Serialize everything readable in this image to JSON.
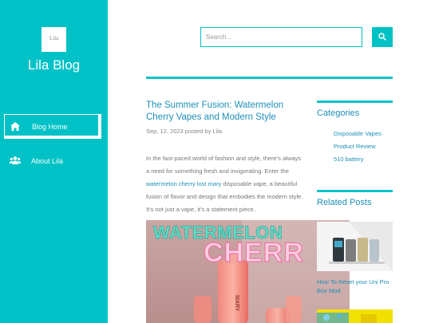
{
  "sidebar": {
    "logo_text": "Lila",
    "blog_title": "Lila Blog",
    "nav": [
      {
        "label": "Blog Home",
        "icon": "home-icon"
      },
      {
        "label": "About Lila",
        "icon": "users-icon"
      }
    ]
  },
  "search": {
    "placeholder": "Search...",
    "button_icon": "search-icon"
  },
  "post": {
    "title": "The Summer Fusion: Watermelon Cherry Vapes and Modern Style",
    "meta": "Sep, 12, 2023 posted by Lila",
    "body_before": "In the fast-paced world of fashion and style, there's always a need for something fresh and invigorating. Enter the ",
    "body_link": "watermelon cherry lost mary",
    "body_after": " disposable vape, a beautiful fusion of flavor and design that embodies the modern style. It's not just a vape, it's a statement piece..",
    "image_text_1": "WATERMELON",
    "image_text_2": "CHERR",
    "image_text_3": "MARY"
  },
  "categories": {
    "title": "Categories",
    "items": [
      "Disposable Vapes",
      "Product Review",
      "510 battery"
    ]
  },
  "related": {
    "title": "Related Posts",
    "items": [
      {
        "title": "How To Reset your Uni Pro Box Mod"
      }
    ]
  },
  "colors": {
    "accent": "#00c2c6",
    "link": "#1d8fb8"
  }
}
